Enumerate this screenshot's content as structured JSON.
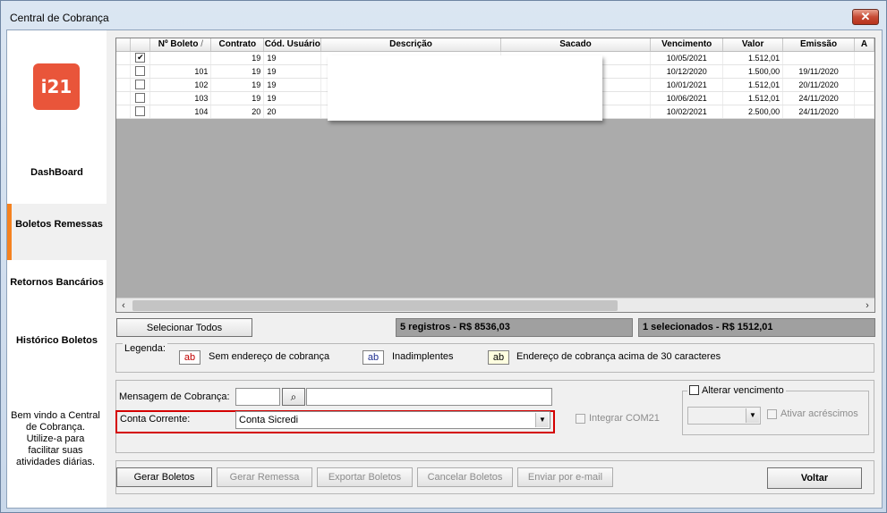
{
  "window": {
    "title": "Central de Cobrança",
    "close_label": "✕"
  },
  "sidebar": {
    "logo_text": "i21",
    "items": [
      {
        "label": "DashBoard"
      },
      {
        "label": "Boletos Remessas"
      },
      {
        "label": "Retornos Bancários"
      },
      {
        "label": "Histórico Boletos"
      }
    ],
    "welcome": "Bem vindo a Central de Cobrança. Utilize-a para facilitar suas atividades diárias."
  },
  "grid": {
    "columns": [
      "",
      "Nº Boleto",
      "Contrato",
      "Cód. Usuário",
      "Descrição",
      "Sacado",
      "Vencimento",
      "Valor",
      "Emissão",
      "A"
    ],
    "sort_indicator": "/",
    "rows": [
      {
        "checked": true,
        "boleto": "",
        "contrato": "19",
        "usuario": "19",
        "vencimento": "10/05/2021",
        "valor": "1.512,01",
        "emissao": ""
      },
      {
        "checked": false,
        "boleto": "101",
        "contrato": "19",
        "usuario": "19",
        "vencimento": "10/12/2020",
        "valor": "1.500,00",
        "emissao": "19/11/2020"
      },
      {
        "checked": false,
        "boleto": "102",
        "contrato": "19",
        "usuario": "19",
        "vencimento": "10/01/2021",
        "valor": "1.512,01",
        "emissao": "20/11/2020"
      },
      {
        "checked": false,
        "boleto": "103",
        "contrato": "19",
        "usuario": "19",
        "vencimento": "10/06/2021",
        "valor": "1.512,01",
        "emissao": "24/11/2020"
      },
      {
        "checked": false,
        "boleto": "104",
        "contrato": "20",
        "usuario": "20",
        "vencimento": "10/02/2021",
        "valor": "2.500,00",
        "emissao": "24/11/2020"
      }
    ]
  },
  "actions": {
    "select_all": "Selecionar Todos",
    "total_status": "5 registros - R$ 8536,03",
    "selected_status": "1 selecionados - R$ 1512,01"
  },
  "legend": {
    "title": "Legenda:",
    "items": [
      {
        "swatch": "ab",
        "color": "#c00000",
        "label": "Sem endereço de cobrança"
      },
      {
        "swatch": "ab",
        "color": "#1f2f8f",
        "label": "Inadimplentes"
      },
      {
        "swatch": "ab",
        "color": "#000000",
        "bg": "#ffffe0",
        "label": "Endereço de cobrança acima de 30 caracteres"
      }
    ]
  },
  "form": {
    "mensagem_label": "Mensagem de Cobrança:",
    "mensagem_code": "",
    "mensagem_text": "",
    "conta_label": "Conta Corrente:",
    "conta_value": "Conta Sicredi",
    "integrar_label": "Integrar COM21",
    "alterar_label": "Alterar vencimento",
    "ativar_label": "Ativar acréscimos"
  },
  "buttons": {
    "gerar_boletos": "Gerar  Boletos",
    "gerar_remessa": "Gerar Remessa",
    "exportar": "Exportar Boletos",
    "cancelar": "Cancelar Boletos",
    "enviar": "Enviar por e-mail",
    "voltar": "Voltar"
  }
}
